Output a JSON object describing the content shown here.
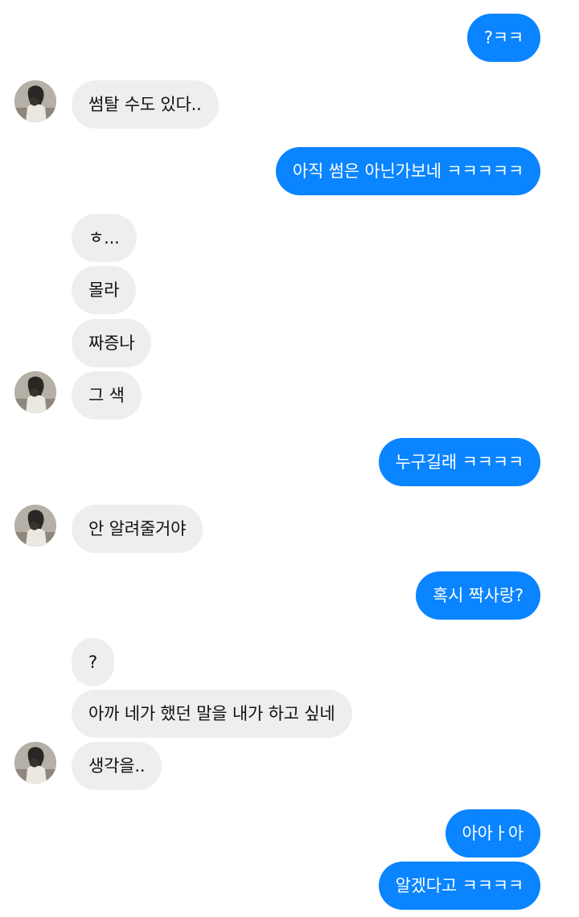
{
  "avatar": {
    "icon": "profile-photo-avatar"
  },
  "colors": {
    "sent_bubble": "#0a84ff",
    "received_bubble": "#eeeeee",
    "background": "#ffffff"
  },
  "messages": [
    {
      "from": "me",
      "text": "?ㅋㅋ"
    },
    {
      "from": "them",
      "text": "썸탈 수도 있다.."
    },
    {
      "from": "me",
      "text": "아직 썸은 아닌가보네 ㅋㅋㅋㅋㅋ"
    },
    {
      "from": "them",
      "text": "ㅎ..."
    },
    {
      "from": "them",
      "text": "몰라"
    },
    {
      "from": "them",
      "text": "짜증나"
    },
    {
      "from": "them",
      "text": "그 색"
    },
    {
      "from": "me",
      "text": "누구길래 ㅋㅋㅋㅋ"
    },
    {
      "from": "them",
      "text": "안 알려줄거야"
    },
    {
      "from": "me",
      "text": "혹시 짝사랑?"
    },
    {
      "from": "them",
      "text": "?"
    },
    {
      "from": "them",
      "text": "아까 네가 했던 말을 내가 하고 싶네"
    },
    {
      "from": "them",
      "text": "생각을.."
    },
    {
      "from": "me",
      "text": "아아ㅏ아"
    },
    {
      "from": "me",
      "text": "알겠다고 ㅋㅋㅋㅋ"
    }
  ]
}
